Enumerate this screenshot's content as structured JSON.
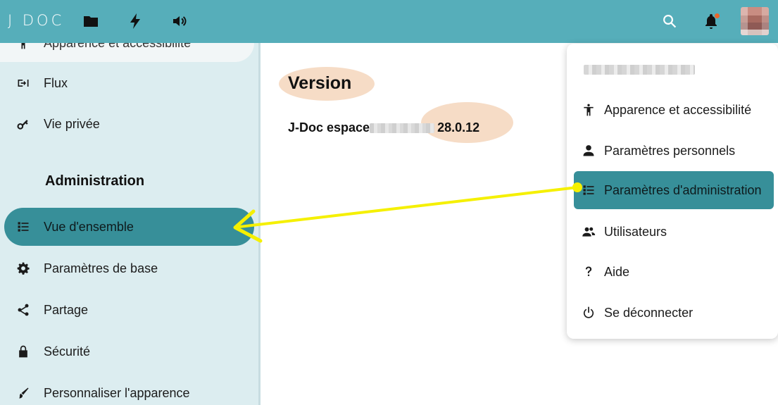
{
  "header": {
    "logo": "J DOC",
    "icons": [
      "folder-icon",
      "lightning-icon",
      "speaker-icon",
      "search-icon",
      "bell-icon"
    ],
    "notification_dot_color": "#e9662c",
    "background_color": "#56aeba"
  },
  "sidebar": {
    "top_item_label": "Apparence et accessibilité",
    "items_before": [
      {
        "label": "Flux",
        "icon": "feed-icon"
      },
      {
        "label": "Vie privée",
        "icon": "key-icon"
      }
    ],
    "section_title": "Administration",
    "admin_items": [
      {
        "label": "Vue d'ensemble",
        "icon": "list-icon",
        "active": true
      },
      {
        "label": "Paramètres de base",
        "icon": "gear-icon"
      },
      {
        "label": "Partage",
        "icon": "share-icon"
      },
      {
        "label": "Sécurité",
        "icon": "lock-icon"
      },
      {
        "label": "Personnaliser l'apparence",
        "icon": "brush-icon"
      }
    ],
    "active_color": "#378f99",
    "background_color": "#dcedf0"
  },
  "main": {
    "version_title": "Version",
    "version_prefix": "J-Doc espace",
    "version_number": "28.0.12",
    "highlight_color": "#f6dcc6"
  },
  "user_menu": {
    "items": [
      {
        "label": "Apparence et accessibilité",
        "icon": "accessibility-icon"
      },
      {
        "label": "Paramètres personnels",
        "icon": "person-icon"
      },
      {
        "label": "Paramètres d'administration",
        "icon": "list-icon",
        "active": true
      },
      {
        "label": "Utilisateurs",
        "icon": "users-icon"
      },
      {
        "label": "Aide",
        "icon": "help-icon"
      },
      {
        "label": "Se déconnecter",
        "icon": "power-icon"
      }
    ]
  },
  "annotation": {
    "arrow_color": "#f5f000"
  }
}
